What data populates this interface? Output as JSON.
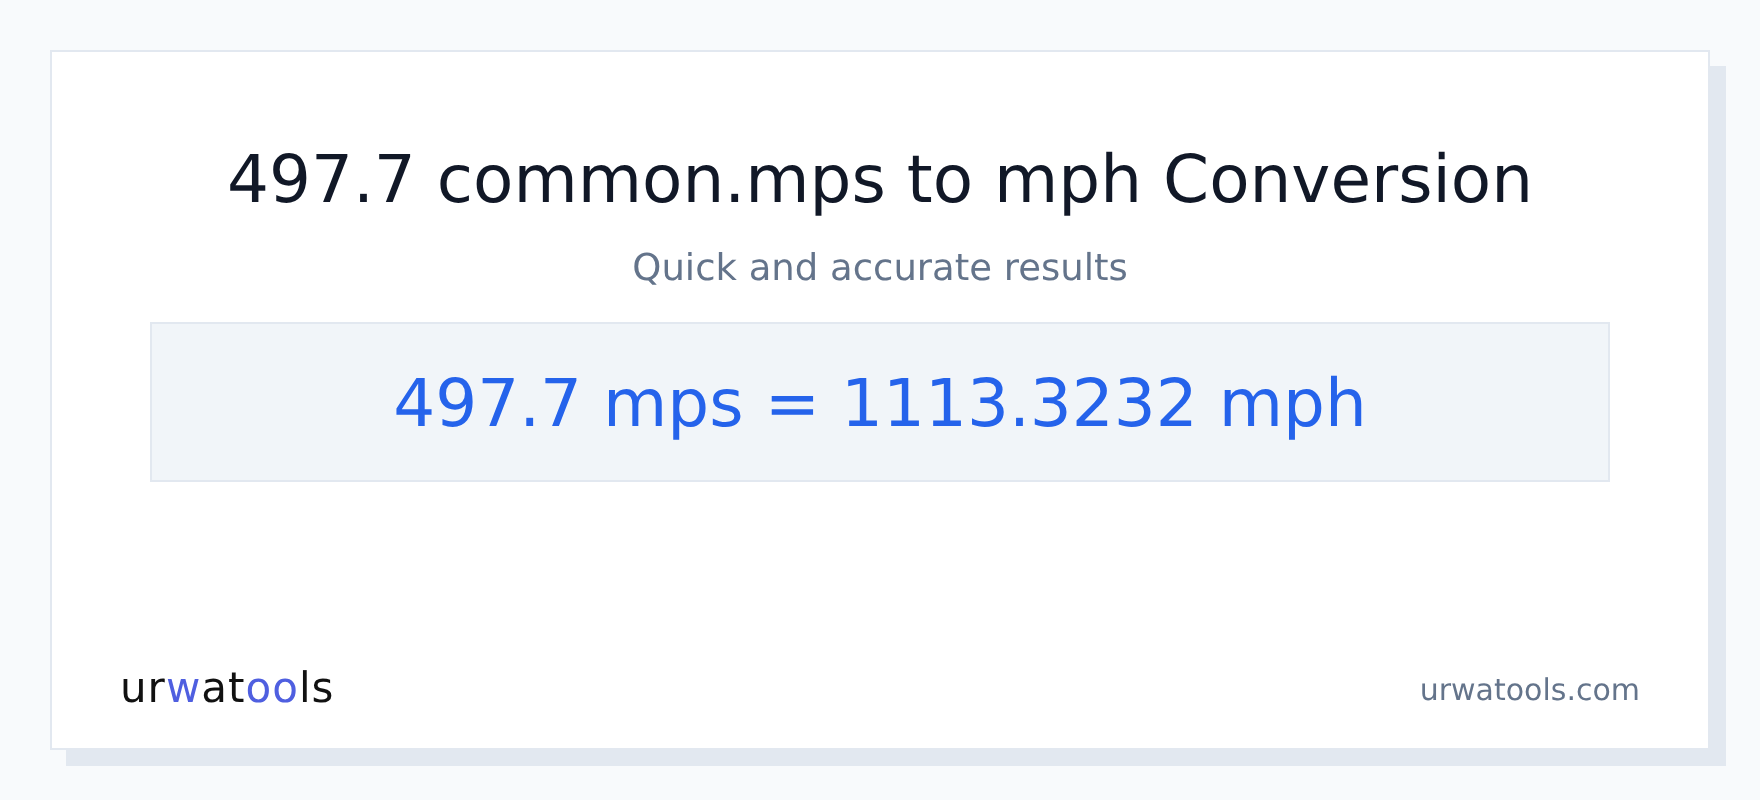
{
  "title": "497.7 common.mps to mph Conversion",
  "subtitle": "Quick and accurate results",
  "result": "497.7 mps = 1113.3232 mph",
  "logo": [
    {
      "text": "ur",
      "accent": false
    },
    {
      "text": "w",
      "accent": true
    },
    {
      "text": "at",
      "accent": false
    },
    {
      "text": "oo",
      "accent": true
    },
    {
      "text": "ls",
      "accent": false
    }
  ],
  "site": "urwatools.com"
}
